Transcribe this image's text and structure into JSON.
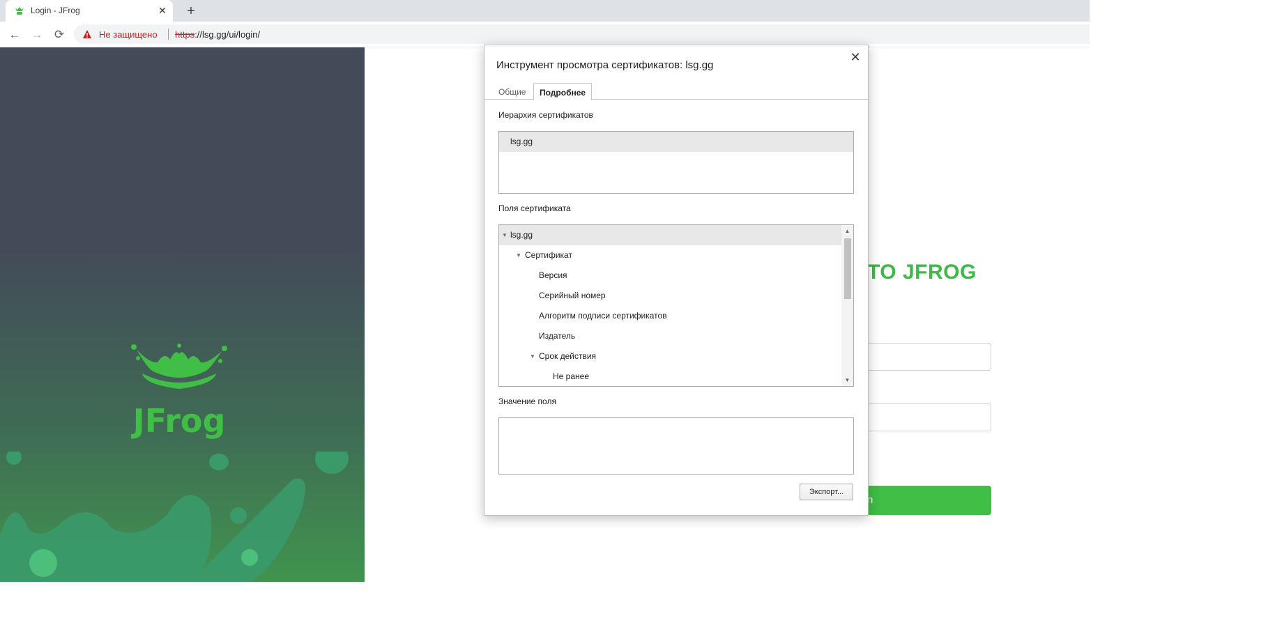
{
  "browser": {
    "tab": {
      "title": "Login - JFrog",
      "close_symbol": "✕"
    },
    "new_tab_symbol": "+",
    "toolbar": {
      "back_symbol": "←",
      "forward_symbol": "→",
      "reload_symbol": "⟳",
      "security_label": "Не защищено",
      "url_scheme": "https",
      "url_rest": "://lsg.gg/ui/login/"
    }
  },
  "page": {
    "heading": "TO JFROG",
    "login_button_fragment": "n",
    "brand_colors": {
      "green": "#40be46",
      "hero_dark": "#434a58"
    }
  },
  "dialog": {
    "title": "Инструмент просмотра сертификатов: lsg.gg",
    "close_symbol": "✕",
    "tabs": [
      "Общие",
      "Подробнее"
    ],
    "active_tab": "Подробнее",
    "hierarchy": {
      "label": "Иерархия сертификатов",
      "items": [
        "lsg.gg"
      ]
    },
    "fields": {
      "label": "Поля сертификата",
      "items": [
        {
          "label": "lsg.gg",
          "level": 0,
          "expanded": true
        },
        {
          "label": "Сертификат",
          "level": 1,
          "expanded": true
        },
        {
          "label": "Версия",
          "level": 2
        },
        {
          "label": "Серийный номер",
          "level": 2
        },
        {
          "label": "Алгоритм подписи сертификатов",
          "level": 2
        },
        {
          "label": "Издатель",
          "level": 2
        },
        {
          "label": "Срок действия",
          "level": 2,
          "expanded": true
        },
        {
          "label": "Не ранее",
          "level": 3
        }
      ]
    },
    "value": {
      "label": "Значение поля",
      "text": ""
    },
    "export_button": "Экспорт..."
  }
}
